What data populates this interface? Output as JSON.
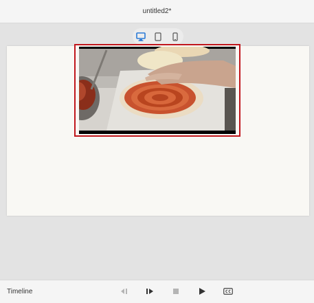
{
  "window": {
    "title": "untitled2*"
  },
  "device_switcher": {
    "options": [
      {
        "icon": "desktop-icon",
        "active": true
      },
      {
        "icon": "tablet-icon",
        "active": false
      },
      {
        "icon": "phone-icon",
        "active": false
      }
    ],
    "active_color": "#2a7ad6"
  },
  "stage": {
    "selection_color": "#c0161c",
    "media": {
      "type": "video",
      "subject": "pizza-making-video-still"
    }
  },
  "timeline": {
    "label": "Timeline",
    "controls": [
      {
        "icon": "step-back-icon",
        "enabled": false
      },
      {
        "icon": "step-forward-icon",
        "enabled": true
      },
      {
        "icon": "stop-icon",
        "enabled": false
      },
      {
        "icon": "play-icon",
        "enabled": true
      },
      {
        "icon": "closed-captions-icon",
        "enabled": true
      }
    ]
  }
}
